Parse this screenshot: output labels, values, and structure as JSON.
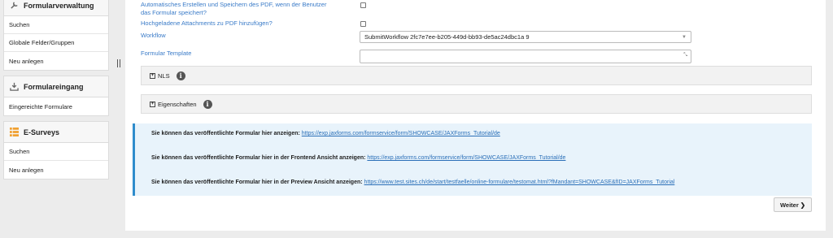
{
  "sidebar": {
    "panels": [
      {
        "title": "Formularverwaltung",
        "icon": "wrench-icon",
        "items": [
          "Suchen",
          "Globale Felder/Gruppen",
          "Neu anlegen"
        ]
      },
      {
        "title": "Formulareingang",
        "icon": "download-tray-icon",
        "items": [
          "Eingereichte Formulare"
        ]
      },
      {
        "title": "E-Surveys",
        "icon": "survey-grid-icon",
        "items": [
          "Suchen",
          "Neu anlegen"
        ]
      }
    ]
  },
  "form": {
    "auto_pdf_label": "Automatisches Erstellen und Speichern des PDF, wenn der Benutzer das Formular speichert?",
    "attachments_label": "Hochgeladene Attachments zu PDF hinzufügen?",
    "workflow_label": "Workflow",
    "workflow_value": "SubmitWorkflow 2fc7e7ee-b205-449d-bb93-de5ac24dbc1a 9",
    "template_label": "Formular Template",
    "template_value": ""
  },
  "sections": {
    "nls": "NLS",
    "eigenschaften": "Eigenschaften"
  },
  "info": {
    "line1_text": "Sie können das veröffentlichte Formular hier anzeigen:",
    "line1_link": "https://exp.jaxforms.com/formservice/form/SHOWCASE/JAXForms_Tutorial/de",
    "line2_text": "Sie können das veröffentlichte Formular hier in der Frontend Ansicht anzeigen:",
    "line2_link": "https://exp.jaxforms.com/formservice/form/SHOWCASE/JAXForms_Tutorial/de",
    "line3_text": "Sie können das veröffentlichte Formular hier in der Preview Ansicht anzeigen:",
    "line3_link": "https://www.test.sites.ch/de/start/testfaelle/online-formulare/testomat.html?fMandant=SHOWCASE&fID=JAXForms_Tutorial"
  },
  "actions": {
    "weiter_label": "Weiter",
    "weiter_glyph": "❯"
  },
  "colors": {
    "label_blue": "#3a7bc8",
    "info_bg": "#e8f3fb",
    "info_border": "#2f8ccc",
    "survey_orange": "#f0a030"
  }
}
